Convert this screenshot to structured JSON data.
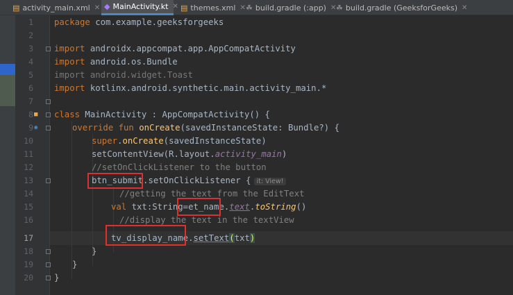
{
  "tabs": [
    {
      "label": "activity_main.xml",
      "icon": "xml-file-icon"
    },
    {
      "label": "MainActivity.kt",
      "icon": "kotlin-file-icon",
      "active": true
    },
    {
      "label": "themes.xml",
      "icon": "xml-file-icon"
    },
    {
      "label": "build.gradle (:app)",
      "icon": "gradle-icon"
    },
    {
      "label": "build.gradle (GeeksforGeeks)",
      "icon": "gradle-icon"
    }
  ],
  "line_numbers": [
    "1",
    "2",
    "3",
    "4",
    "5",
    "6",
    "7",
    "8",
    "9",
    "10",
    "11",
    "12",
    "13",
    "14",
    "15",
    "16",
    "17",
    "18",
    "19",
    "20"
  ],
  "code": {
    "l1_kw": "package",
    "l1_rest": " com.example.geeksforgeeks",
    "l3_kw": "import",
    "l3_rest": " androidx.appcompat.app.AppCompatActivity",
    "l4_kw": "import",
    "l4_rest": " android.os.Bundle",
    "l5": "import android.widget.Toast",
    "l6_kw": "import",
    "l6_rest": " kotlinx.android.synthetic.main.activity_main.*",
    "l8_kw": "class",
    "l8_rest": " MainActivity : AppCompatActivity() {",
    "l9_kw": "override fun",
    "l9_fn": "onCreate",
    "l9_rest": "(savedInstanceState: Bundle?) {",
    "l10_kw": "super",
    "l10_fn": "onCreate",
    "l10_rest": "(savedInstanceState)",
    "l11_a": "setContentView(R.layout.",
    "l11_it": "activity_main",
    "l11_b": ")",
    "l12": "//setOnClickListener to the button",
    "l13_a": "btn_submit",
    "l13_b": ".setOnClickListener {",
    "l13_hint": "it: View!",
    "l14": "//getting the text from the EditText",
    "l15_kw": "val",
    "l15_a": " txt:String=",
    "l15_b": "et_name",
    "l15_c": ".",
    "l15_it": "text",
    "l15_d": ".",
    "l15_ext": "toString",
    "l15_e": "()",
    "l16": "//display the text in the textView",
    "l17_a": "tv_display_name",
    "l17_b": ".",
    "l17_c": "setText",
    "l17_p1": "(",
    "l17_d": "txt",
    "l17_p2": ")",
    "l18": "}",
    "l19": "}",
    "l20": "}"
  },
  "colors": {
    "keyword": "#cc7832",
    "function": "#ffc66d",
    "comment": "#808080",
    "highlight_box": "#e0302b"
  }
}
